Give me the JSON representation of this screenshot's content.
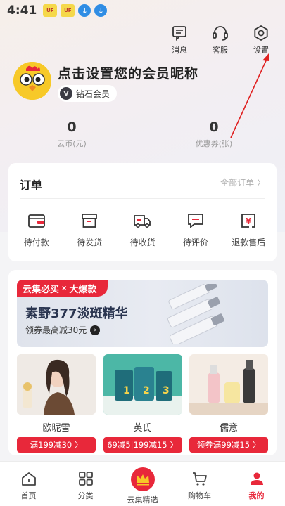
{
  "status_bar": {
    "time": "4:41",
    "app_icon_1": "UF",
    "app_icon_2": "UF",
    "icons": [
      "app-icon",
      "app-icon",
      "download-icon",
      "download-icon"
    ]
  },
  "top_actions": [
    {
      "label": "消息",
      "icon": "message-icon"
    },
    {
      "label": "客服",
      "icon": "headset-icon"
    },
    {
      "label": "设置",
      "icon": "settings-icon"
    }
  ],
  "profile": {
    "nickname": "点击设置您的会员昵称",
    "member_level": "钻石会员",
    "member_icon_letter": "V"
  },
  "stats": [
    {
      "value": "0",
      "label": "云币(元)"
    },
    {
      "value": "0",
      "label": "优惠券(张)"
    }
  ],
  "orders": {
    "title": "订单",
    "all_link": "全部订单 〉",
    "items": [
      {
        "label": "待付款",
        "icon": "wallet-icon"
      },
      {
        "label": "待发货",
        "icon": "box-icon"
      },
      {
        "label": "待收货",
        "icon": "truck-icon"
      },
      {
        "label": "待评价",
        "icon": "comment-icon"
      },
      {
        "label": "退款售后",
        "icon": "refund-icon"
      }
    ]
  },
  "promo": {
    "tag_left": "云集必买",
    "tag_x": "×",
    "tag_right": "大爆款",
    "banner_title": "素野377淡斑精华",
    "banner_sub": "领券最高减30元",
    "products": [
      {
        "name": "欧昵雪",
        "tag": "满199减30 〉"
      },
      {
        "name": "英氏",
        "tag": "69减5|199减15 〉"
      },
      {
        "name": "儒意",
        "tag": "领券满99减15 〉"
      }
    ]
  },
  "tab_bar": {
    "items": [
      {
        "label": "首页",
        "icon": "home-icon"
      },
      {
        "label": "分类",
        "icon": "grid-icon"
      },
      {
        "label": "云集精选",
        "icon": "crown-icon"
      },
      {
        "label": "购物车",
        "icon": "cart-icon"
      },
      {
        "label": "我的",
        "icon": "user-icon"
      }
    ],
    "active": "我的"
  },
  "colors": {
    "accent": "#e8283a",
    "annotation_arrow": "#e02020"
  }
}
